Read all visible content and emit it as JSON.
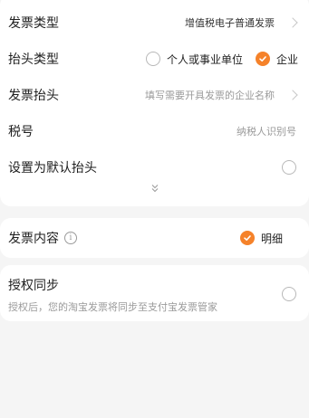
{
  "invoice_form": {
    "invoice_type": {
      "label": "发票类型",
      "value": "增值税电子普通发票"
    },
    "title_type": {
      "label": "抬头类型",
      "options": [
        {
          "label": "个人或事业单位",
          "selected": false
        },
        {
          "label": "企业",
          "selected": true
        }
      ]
    },
    "invoice_title": {
      "label": "发票抬头",
      "placeholder": "填写需要开具发票的企业名称"
    },
    "tax_id": {
      "label": "税号",
      "placeholder": "纳税人识别号"
    },
    "set_default": {
      "label": "设置为默认抬头",
      "checked": false
    },
    "expand_icon": "double-chevron-down-icon"
  },
  "invoice_content": {
    "label": "发票内容",
    "info_icon": "info-icon",
    "option": {
      "label": "明细",
      "selected": true
    }
  },
  "authorization": {
    "title": "授权同步",
    "description": "授权后，您的淘宝发票将同步至支付宝发票管家",
    "checked": false
  },
  "colors": {
    "accent": "#f5822a",
    "background": "#f5f5f5",
    "card": "#ffffff",
    "muted_text": "#9a9a9a"
  }
}
